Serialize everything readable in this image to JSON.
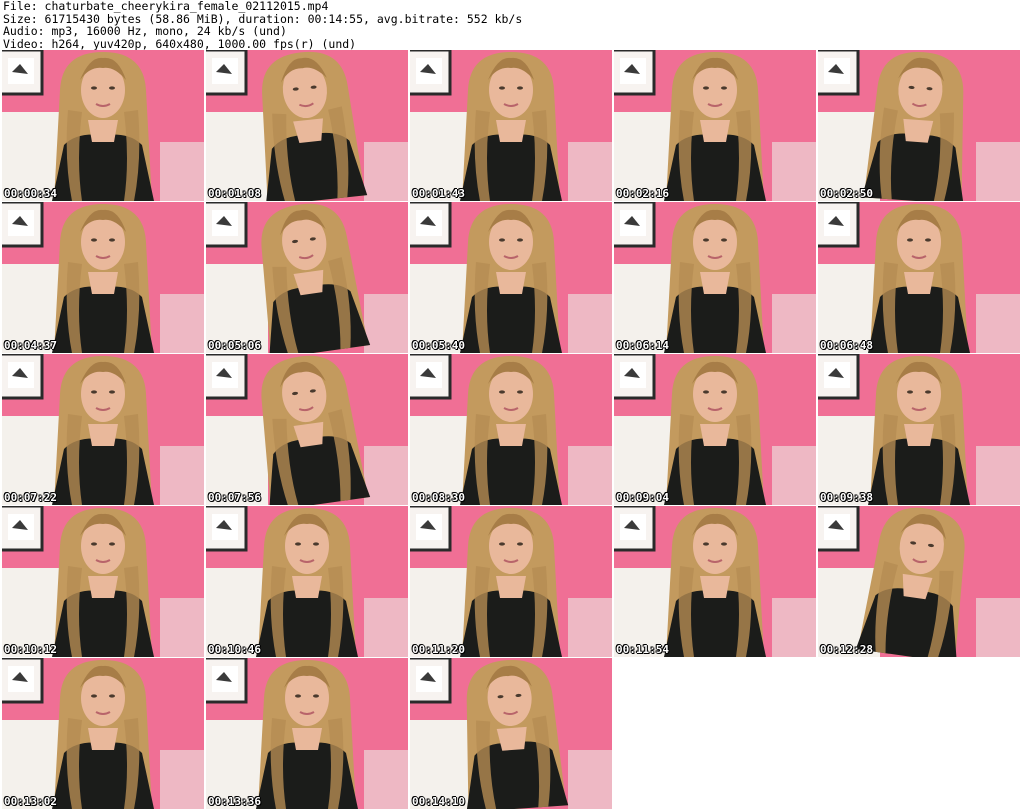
{
  "header": {
    "file": "File: chaturbate_cheerykira_female_02112015.mp4",
    "size": "Size: 61715430 bytes (58.86 MiB), duration: 00:14:55, avg.bitrate: 552 kb/s",
    "audio": "Audio: mp3, 16000 Hz, mono, 24 kb/s (und)",
    "video": "Video: h264, yuv420p, 640x480, 1000.00 fps(r) (und)"
  },
  "colors": {
    "wall": "#f06f95",
    "sofa": "#f4f1ec",
    "hair": "#c39a5e",
    "skin": "#e9b89b",
    "top": "#1b1c1a"
  },
  "thumbnails": [
    {
      "time": "00:00:34",
      "tilt": 0
    },
    {
      "time": "00:01:08",
      "tilt": -6
    },
    {
      "time": "00:01:43",
      "tilt": 0
    },
    {
      "time": "00:02:16",
      "tilt": 0
    },
    {
      "time": "00:02:50",
      "tilt": 4
    },
    {
      "time": "00:04:37",
      "tilt": 0
    },
    {
      "time": "00:05:06",
      "tilt": -8
    },
    {
      "time": "00:05:40",
      "tilt": 0
    },
    {
      "time": "00:06:14",
      "tilt": 0
    },
    {
      "time": "00:06:48",
      "tilt": 0
    },
    {
      "time": "00:07:22",
      "tilt": 0
    },
    {
      "time": "00:07:56",
      "tilt": -8
    },
    {
      "time": "00:08:30",
      "tilt": 0
    },
    {
      "time": "00:09:04",
      "tilt": 0
    },
    {
      "time": "00:09:38",
      "tilt": 0
    },
    {
      "time": "00:10:12",
      "tilt": 0
    },
    {
      "time": "00:10:46",
      "tilt": 0
    },
    {
      "time": "00:11:20",
      "tilt": 0
    },
    {
      "time": "00:11:54",
      "tilt": 0
    },
    {
      "time": "00:12:28",
      "tilt": 8
    },
    {
      "time": "00:13:02",
      "tilt": 0
    },
    {
      "time": "00:13:36",
      "tilt": 0
    },
    {
      "time": "00:14:10",
      "tilt": -4
    }
  ]
}
